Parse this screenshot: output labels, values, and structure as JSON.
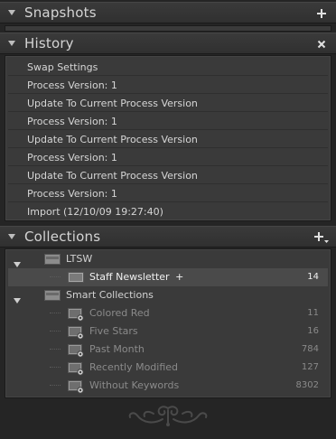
{
  "snapshots": {
    "title": "Snapshots",
    "add_icon": "plus-icon"
  },
  "history": {
    "title": "History",
    "clear_icon": "close-icon",
    "items": [
      "Swap Settings",
      "Process Version: 1",
      "Update To Current Process Version",
      "Process Version: 1",
      "Update To Current Process Version",
      "Process Version: 1",
      "Update To Current Process Version",
      "Process Version: 1",
      "Import (12/10/09 19:27:40)"
    ]
  },
  "collections": {
    "title": "Collections",
    "add_icon": "plus-dropdown-icon",
    "sets": [
      {
        "label": "LTSW",
        "children": [
          {
            "label": "Staff Newsletter",
            "target_marker": "+",
            "count": "14"
          }
        ]
      },
      {
        "label": "Smart Collections",
        "children": [
          {
            "label": "Colored Red",
            "count": "11"
          },
          {
            "label": "Five Stars",
            "count": "16"
          },
          {
            "label": "Past Month",
            "count": "784"
          },
          {
            "label": "Recently Modified",
            "count": "127"
          },
          {
            "label": "Without Keywords",
            "count": "8302"
          }
        ]
      }
    ]
  },
  "footer": {
    "ornament_icon": "panel-end-ornament-icon"
  },
  "colors": {
    "background": "#252525",
    "panel_header": "#333333",
    "panel_body": "#3a3a3a",
    "text": "#d6d6d6",
    "dim_text": "#8a8a8a"
  }
}
